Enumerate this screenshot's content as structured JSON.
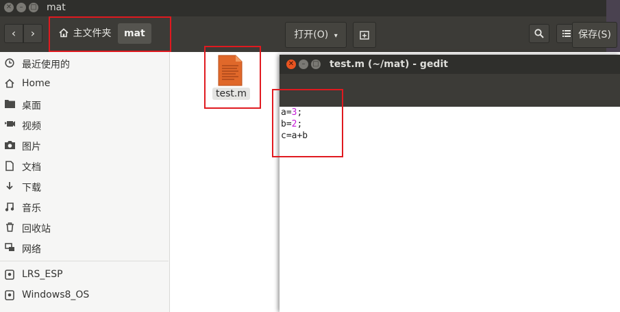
{
  "window": {
    "title": "mat",
    "buttons": [
      "close",
      "minimize",
      "maximize"
    ]
  },
  "toolbar": {
    "back_icon": "chevron-left-icon",
    "forward_icon": "chevron-right-icon",
    "breadcrumb_home": "主文件夹",
    "breadcrumb_current": "mat",
    "search_icon": "search-icon",
    "list_view_icon": "list-view-icon",
    "grid_view_icon": "grid-view-icon"
  },
  "sidebar": {
    "items": [
      {
        "label": "最近使用的",
        "icon": "clock-icon"
      },
      {
        "label": "Home",
        "icon": "home-icon"
      },
      {
        "label": "桌面",
        "icon": "folder-icon"
      },
      {
        "label": "视频",
        "icon": "video-icon"
      },
      {
        "label": "图片",
        "icon": "camera-icon"
      },
      {
        "label": "文档",
        "icon": "document-icon"
      },
      {
        "label": "下载",
        "icon": "download-icon"
      },
      {
        "label": "音乐",
        "icon": "music-icon"
      },
      {
        "label": "回收站",
        "icon": "trash-icon"
      },
      {
        "label": "网络",
        "icon": "network-icon"
      },
      {
        "label": "LRS_ESP",
        "icon": "drive-icon"
      },
      {
        "label": "Windows8_OS",
        "icon": "drive-icon"
      }
    ]
  },
  "files": [
    {
      "name": "test.m",
      "icon": "text-file-icon"
    }
  ],
  "gedit": {
    "title": "test.m (~/mat) - gedit",
    "open_label": "打开(O)",
    "new_tab_icon": "new-document-icon",
    "save_label": "保存(S)",
    "code": [
      {
        "pre": "a=",
        "num": "3",
        "post": ";"
      },
      {
        "pre": "b=",
        "num": "2",
        "post": ";"
      },
      {
        "pre": "c=a+b",
        "num": "",
        "post": ""
      }
    ]
  },
  "colors": {
    "titlebar": "#2f2f2c",
    "toolbar": "#3c3b37",
    "highlight": "#e0191f",
    "file_icon": "#e0682a",
    "number": "#c41bd6"
  }
}
